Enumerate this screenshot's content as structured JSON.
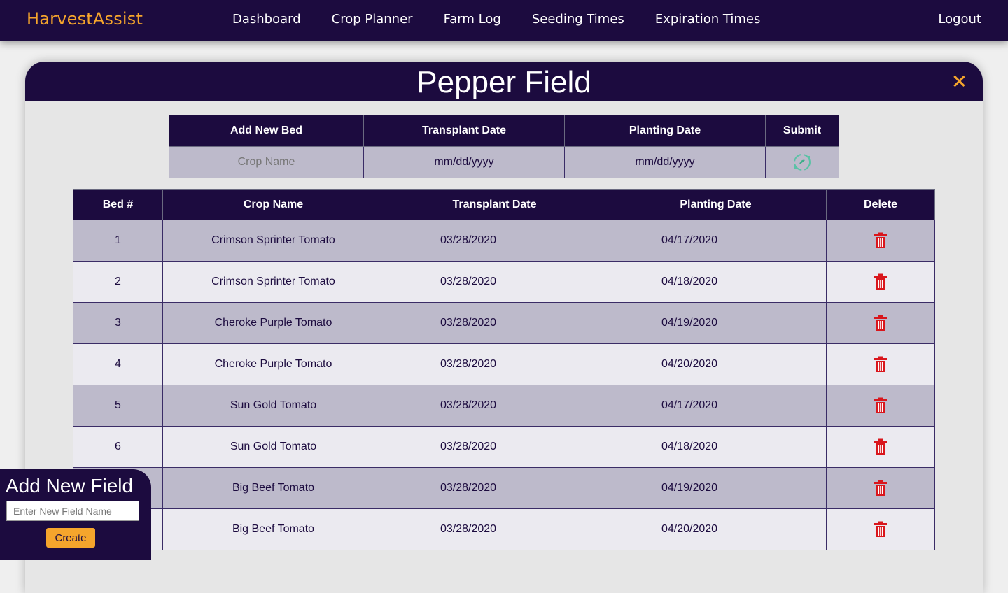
{
  "app": {
    "brand": "HarvestAssist",
    "nav": [
      "Dashboard",
      "Crop Planner",
      "Farm Log",
      "Seeding Times",
      "Expiration Times"
    ],
    "logout": "Logout"
  },
  "field": {
    "title": "Pepper Field"
  },
  "new_bed": {
    "headers": [
      "Add New Bed",
      "Transplant Date",
      "Planting Date",
      "Submit"
    ],
    "crop_placeholder": "Crop Name",
    "transplant_placeholder": "mm/dd/yyyy",
    "planting_placeholder": "mm/dd/yyyy",
    "submit_icon": "refresh-cycle-icon"
  },
  "beds": {
    "headers": [
      "Bed #",
      "Crop Name",
      "Transplant Date",
      "Planting Date",
      "Delete"
    ],
    "rows": [
      {
        "bed": "1",
        "crop": "Crimson Sprinter Tomato",
        "transplant": "03/28/2020",
        "planting": "04/17/2020"
      },
      {
        "bed": "2",
        "crop": "Crimson Sprinter Tomato",
        "transplant": "03/28/2020",
        "planting": "04/18/2020"
      },
      {
        "bed": "3",
        "crop": "Cheroke Purple Tomato",
        "transplant": "03/28/2020",
        "planting": "04/19/2020"
      },
      {
        "bed": "4",
        "crop": "Cheroke Purple Tomato",
        "transplant": "03/28/2020",
        "planting": "04/20/2020"
      },
      {
        "bed": "5",
        "crop": "Sun Gold Tomato",
        "transplant": "03/28/2020",
        "planting": "04/17/2020"
      },
      {
        "bed": "6",
        "crop": "Sun Gold Tomato",
        "transplant": "03/28/2020",
        "planting": "04/18/2020"
      },
      {
        "bed": "",
        "crop": "Big Beef Tomato",
        "transplant": "03/28/2020",
        "planting": "04/19/2020"
      },
      {
        "bed": "",
        "crop": "Big Beef Tomato",
        "transplant": "03/28/2020",
        "planting": "04/20/2020"
      }
    ],
    "delete_icon": "trash-icon"
  },
  "add_field": {
    "title": "Add New Field",
    "placeholder": "Enter New Field Name",
    "button": "Create"
  },
  "colors": {
    "primary": "#1c0b3f",
    "accent": "#f5a52c",
    "delete": "#d9161c",
    "row_odd": "#bdbacb",
    "row_even": "#ebeaf0"
  }
}
